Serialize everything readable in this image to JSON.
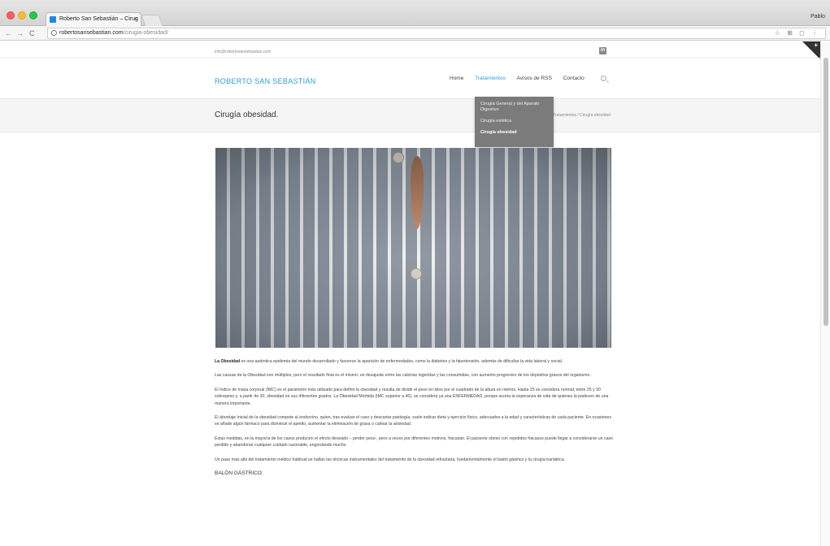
{
  "browser": {
    "tab_title": "Roberto San Sebastián – Cirug",
    "user_name": "Pablo",
    "url_host": "robertosansebastian.com",
    "url_path": "/cirugia-obesidad/",
    "back_glyph": "←",
    "forward_glyph": "→",
    "reload_glyph": "C",
    "close_glyph": "×",
    "right_icons": "☆ ⊞ ◻ ⋮"
  },
  "site": {
    "email": "info@robertosansebastian.com",
    "logo": "ROBERTO SAN SEBASTIÁN",
    "social_glyph": "in",
    "nav": [
      {
        "label": "Home"
      },
      {
        "label": "Tratamientos"
      },
      {
        "label": "Avisos de RSS"
      },
      {
        "label": "Contacto"
      }
    ],
    "dropdown": [
      {
        "label": "Cirugía General y del Aparato Digestivo"
      },
      {
        "label": "Cirugía estética"
      },
      {
        "label": "Cirugía obesidad"
      }
    ],
    "page_title": "Cirugía obesidad.",
    "breadcrumb": "Tratamientos / Cirugía obesidad"
  },
  "article": {
    "p1_strong": "La Obesidad",
    "p1": " es una auténtica epidemia del mundo desarrollado y favorece la aparición de enfermedades, como la diabetes y la hipertensión, además de dificultar la vida laboral y social.",
    "p2": "Las causas de la Obesidad son múltiples, pero el resultado final es el mismo: un desajuste entre las calorías ingeridas y las consumidas, con aumento progresivo de los depósitos grasos del organismo.",
    "p3": "El índice de masa corporal (IMC) es el parámetro más utilizado para definir la obesidad y resulta de dividir el peso en kilos por el cuadrado de la altura en metros. Hasta 25 se considera normal; entre 25 y 30 sobrepeso y, a partir de 30, obesidad en sus diferentes grados. La Obesidad Mórbida (IMC superior a 40), se considera ya una ENFERMEDAD, porque acorta la esperanza de vida de quienes la padecen de una manera importante.",
    "p4": "El abordaje inicial de la obesidad compete al endocrino, quien, tras evaluar el caso y descartar patología, suele indicar dieta y ejercicio físico, adecuados a la edad y características de cada paciente. En ocasiones se añade algún fármaco para disminuir el apetito, aumentar la eliminación de grasa o calmar la ansiedad.",
    "p5": "Estas medidas, en la mayoría de los casos producen el efecto deseado – perder peso-, pero a veces por diferentes motivos, fracasan. El paciente obeso con repetidos fracasos puede llegar a considerarse un caso perdido y abandonar cualquier cuidado razonable, engordando mucho.",
    "p6": "Un paso más allá del tratamiento médico habitual se hallan las técnicas instrumentales del tratamiento de la obesidad refractaria, fundamentalmente el balón gástrico y la cirugía bariátrica.",
    "subhead": "BALÓN GÁSTRICO:"
  },
  "colors": {
    "accent": "#2a9fd6",
    "dropdown_bg": "#7b7b7b"
  }
}
